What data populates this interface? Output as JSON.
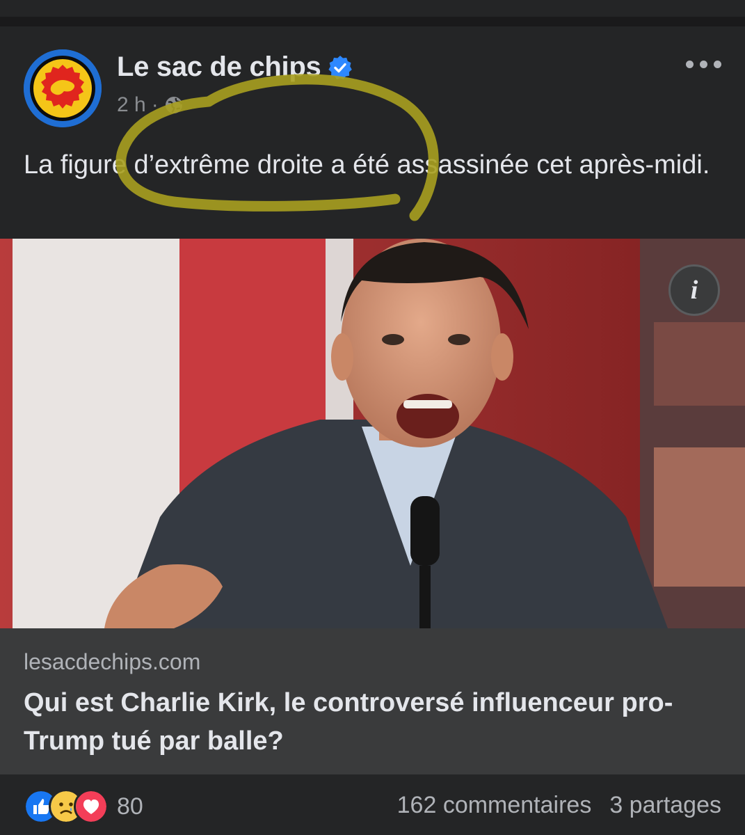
{
  "post": {
    "page_name": "Le sac de chips",
    "verified": true,
    "time": "2 h",
    "separator": "·",
    "audience_icon": "globe-icon",
    "text": "La figure d’extrême droite a été assassinée cet après-midi."
  },
  "photo": {
    "info_label": "i"
  },
  "link": {
    "domain": "lesacdechips.com",
    "headline": "Qui est Charlie Kirk, le controversé influenceur pro-Trump tué par balle?"
  },
  "footer": {
    "reaction_icons": [
      "like-icon",
      "sad-icon",
      "love-icon"
    ],
    "reaction_count": "80",
    "comments": "162 commentaires",
    "shares": "3 partages"
  },
  "colors": {
    "background": "#242526",
    "text": "#e4e6eb",
    "muted": "#b0b3b8",
    "verified": "#2d88ff",
    "highlight_marker": "#a8a020"
  }
}
